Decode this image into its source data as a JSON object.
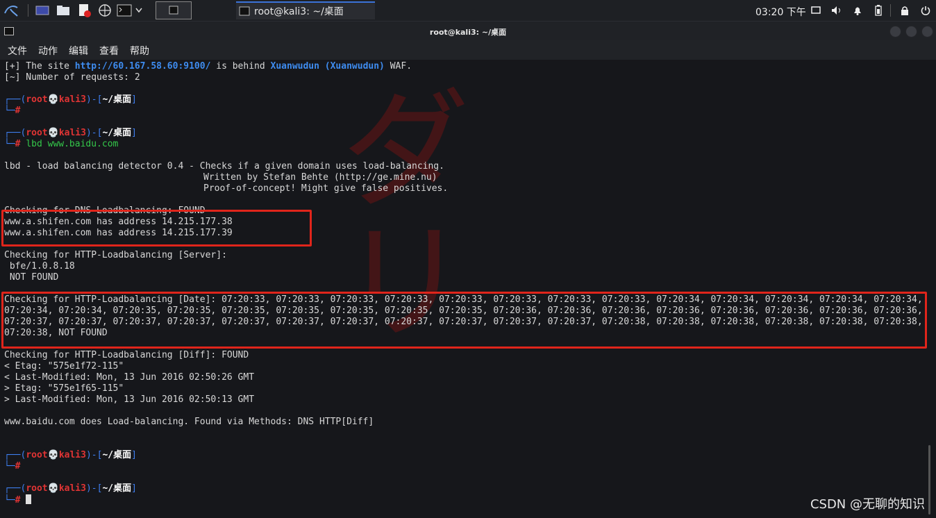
{
  "taskbar": {
    "terminal_window_label": "root@kali3: ~/桌面",
    "clock": "03:20 下午"
  },
  "window": {
    "title": "root@kali3: ~/桌面",
    "menu": [
      "文件",
      "动作",
      "编辑",
      "查看",
      "帮助"
    ]
  },
  "terminal": {
    "waf_prefix": "[+] The site ",
    "waf_url": "http://60.167.58.60:9100/",
    "waf_mid": " is behind ",
    "waf_name": "Xuanwudun (Xuanwudun)",
    "waf_suffix": " WAF.",
    "requests_line": "[~] Number of requests: 2",
    "prompt": {
      "frame_open": "┌──(",
      "user": "root",
      "skull": "💀",
      "host": "kali3",
      "frame_mid": ")-[",
      "dir": "~/桌面",
      "frame_close": "]",
      "frame_bottom": "└─",
      "hash": "#"
    },
    "command": "lbd www.baidu.com",
    "banner": [
      "lbd - load balancing detector 0.4 - Checks if a given domain uses load-balancing.",
      "Written by Stefan Behte (http://ge.mine.nu)",
      "Proof-of-concept! Might give false positives."
    ],
    "dns_check": "Checking for DNS-Loadbalancing: FOUND",
    "dns_results": [
      "www.a.shifen.com has address 14.215.177.38",
      "www.a.shifen.com has address 14.215.177.39"
    ],
    "server_check": "Checking for HTTP-Loadbalancing [Server]:",
    "server_lines": [
      " bfe/1.0.8.18",
      " NOT FOUND"
    ],
    "date_check": "Checking for HTTP-Loadbalancing [Date]: 07:20:33, 07:20:33, 07:20:33, 07:20:33, 07:20:33, 07:20:33, 07:20:33, 07:20:33, 07:20:34, 07:20:34, 07:20:34, 07:20:34, 07:20:34, 07:20:34, 07:20:34, 07:20:35, 07:20:35, 07:20:35, 07:20:35, 07:20:35, 07:20:35, 07:20:35, 07:20:36, 07:20:36, 07:20:36, 07:20:36, 07:20:36, 07:20:36, 07:20:36, 07:20:36, 07:20:37, 07:20:37, 07:20:37, 07:20:37, 07:20:37, 07:20:37, 07:20:37, 07:20:37, 07:20:37, 07:20:37, 07:20:37, 07:20:38, 07:20:38, 07:20:38, 07:20:38, 07:20:38, 07:20:38, 07:20:38, NOT FOUND",
    "diff_check": "Checking for HTTP-Loadbalancing [Diff]: FOUND",
    "diff_lines": [
      "< Etag: \"575e1f72-115\"",
      "< Last-Modified: Mon, 13 Jun 2016 02:50:26 GMT",
      "> Etag: \"575e1f65-115\"",
      "> Last-Modified: Mon, 13 Jun 2016 02:50:13 GMT"
    ],
    "conclusion": "www.baidu.com does Load-balancing. Found via Methods: DNS HTTP[Diff]"
  },
  "watermark": "CSDN @无聊的知识",
  "colors": {
    "highlight_box": "#e0251b",
    "url_blue": "#3e8cf0",
    "prompt_red": "#e03434",
    "command_green": "#34c84a"
  }
}
